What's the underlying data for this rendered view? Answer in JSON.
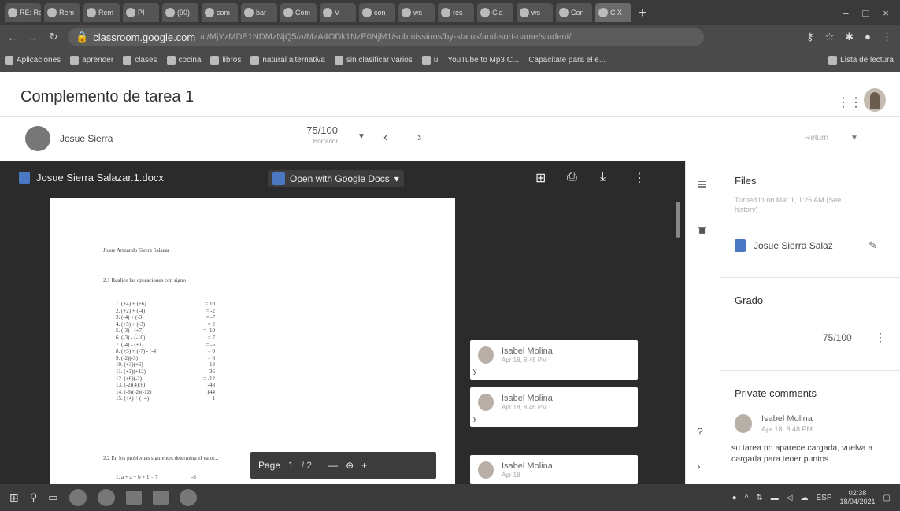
{
  "browser": {
    "tabs": [
      "RE: Rem",
      "Rem",
      "Rem",
      "PI",
      "(90)",
      "com",
      "bar",
      "Com",
      "V",
      "con",
      "ws",
      "res",
      "Cla",
      "ws",
      "Con",
      "C X"
    ],
    "new_tab": "+",
    "window_controls": [
      "–",
      "□",
      "×"
    ],
    "url_host": "classroom.google.com",
    "url_path": "/c/MjYzMDE1NDMzNjQ5/a/MzA4ODk1NzE0NjM1/submissions/by-status/and-sort-name/student/",
    "bookmarks": [
      "Aplicaciones",
      "aprender",
      "clases",
      "cocina",
      "libros",
      "natural alternativa",
      "sin clasificar varios",
      "u",
      "YouTube to Mp3 C...",
      "Capacitate para el e..."
    ],
    "reading_list": "Lista de lectura"
  },
  "classroom": {
    "title": "Complemento de tarea 1",
    "student_name": "Josue Sierra",
    "grade": "75/100",
    "grade_sub": "Borrador",
    "return_label": "Return"
  },
  "viewer": {
    "file_name": "Josue Sierra Salazar.1.docx",
    "open_with": "Open with Google Docs",
    "page_label": "Page",
    "page_current": "1",
    "page_total": "/  2"
  },
  "document": {
    "author": "Josue Armando Sierra Salazar",
    "heading1": "2.1 Realice las operaciones con signo",
    "items": [
      {
        "q": "1.  (+4) + (+6)",
        "a": "= 10"
      },
      {
        "q": "2.  (+2) + (-4)",
        "a": "= -2"
      },
      {
        "q": "3.  (-4) + (-3)",
        "a": "= -7"
      },
      {
        "q": "4.  (+5) + (-3)",
        "a": "= 2"
      },
      {
        "q": "5.  (-3) - (+7)",
        "a": "= -10"
      },
      {
        "q": "6.  (-3) - (-10)",
        "a": "= 7"
      },
      {
        "q": "7.  (-4) - (+1)",
        "a": "= -5"
      },
      {
        "q": "8.  (+3) + (-7) - (-4)",
        "a": "= 0"
      },
      {
        "q": "9.  (-2)(-3)",
        "a": "= 6"
      },
      {
        "q": "10. (+3)(+6)",
        "a": "18"
      },
      {
        "q": "11. (+3)(+12)",
        "a": "36"
      },
      {
        "q": "12. (+6)(-2)",
        "a": "= -12"
      },
      {
        "q": "13. (-2)(4)(6)",
        "a": "-48"
      },
      {
        "q": "14. (-6)(-2)(-12)",
        "a": "144"
      },
      {
        "q": "15. (+4) ÷ (+4)",
        "a": "1"
      }
    ],
    "heading2": "2.2 En los problemas siguientes determina el valor...",
    "last_item": {
      "q": "1.  a + a + b + 1 = 7",
      "a": "-8"
    }
  },
  "comments": [
    {
      "name": "Isabel Molina",
      "date": "Apr 18, 8:45 PM",
      "text": "y"
    },
    {
      "name": "Isabel Molina",
      "date": "Apr 18, 8:46 PM",
      "text": "y"
    },
    {
      "name": "Isabel Molina",
      "date": "Apr 18",
      "text": ""
    }
  ],
  "side_panel": {
    "files_label": "Files",
    "turned_in": "Turned in on Mar 1, 1:26 AM (See history)",
    "attachment_name": "Josue Sierra Salaz",
    "grade_label": "Grado",
    "grade_value": "75/100",
    "private_comments_label": "Private comments",
    "pc_name": "Isabel Molina",
    "pc_date": "Apr 18, 8:48 PM",
    "pc_text": "su tarea no aparece cargada, vuelva a cargarla para tener puntos"
  },
  "taskbar": {
    "lang": "ESP",
    "time": "02:38",
    "date": "18/04/2021"
  }
}
